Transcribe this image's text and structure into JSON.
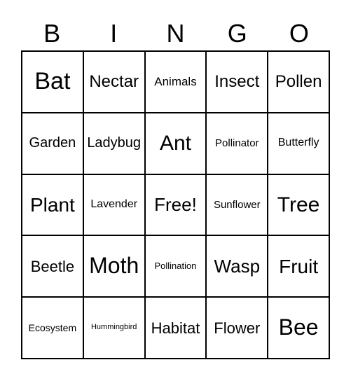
{
  "card": {
    "title": "BINGO",
    "header_letters": [
      "B",
      "I",
      "N",
      "G",
      "O"
    ],
    "columns": 5,
    "rows": 5,
    "free_space": "Free!",
    "free_space_position": {
      "row": 3,
      "column": 3
    },
    "colors": {
      "background": "#ffffff",
      "cell_background": "#ffffff",
      "border": "#000000",
      "text": "#000000"
    },
    "grid": [
      [
        {
          "label": "Bat",
          "size": "fs-34"
        },
        {
          "label": "Nectar",
          "size": "fs-24"
        },
        {
          "label": "Animals",
          "size": "fs-17"
        },
        {
          "label": "Insect",
          "size": "fs-24"
        },
        {
          "label": "Pollen",
          "size": "fs-24"
        }
      ],
      [
        {
          "label": "Garden",
          "size": "fs-20"
        },
        {
          "label": "Ladybug",
          "size": "fs-20"
        },
        {
          "label": "Ant",
          "size": "fs-30"
        },
        {
          "label": "Pollinator",
          "size": "fs-15"
        },
        {
          "label": "Butterfly",
          "size": "fs-16"
        }
      ],
      [
        {
          "label": "Plant",
          "size": "fs-28"
        },
        {
          "label": "Lavender",
          "size": "fs-16"
        },
        {
          "label": "Free!",
          "size": "fs-26"
        },
        {
          "label": "Sunflower",
          "size": "fs-15"
        },
        {
          "label": "Tree",
          "size": "fs-30"
        }
      ],
      [
        {
          "label": "Beetle",
          "size": "fs-22"
        },
        {
          "label": "Moth",
          "size": "fs-32"
        },
        {
          "label": "Pollination",
          "size": "fs-13"
        },
        {
          "label": "Wasp",
          "size": "fs-26"
        },
        {
          "label": "Fruit",
          "size": "fs-28"
        }
      ],
      [
        {
          "label": "Ecosystem",
          "size": "fs-14"
        },
        {
          "label": "Hummingbird",
          "size": "fs-11"
        },
        {
          "label": "Habitat",
          "size": "fs-22"
        },
        {
          "label": "Flower",
          "size": "fs-22"
        },
        {
          "label": "Bee",
          "size": "fs-32"
        }
      ]
    ]
  }
}
